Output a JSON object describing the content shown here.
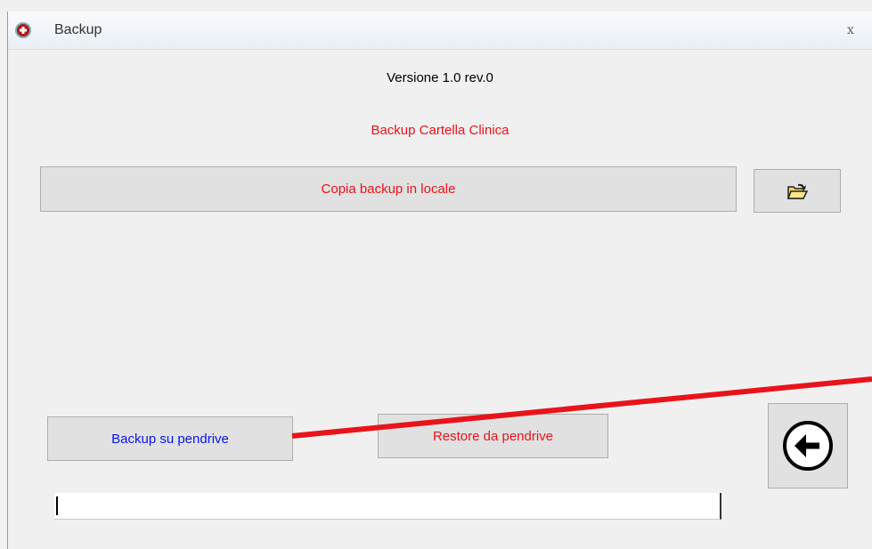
{
  "window": {
    "title": "Backup",
    "close_label": "x"
  },
  "labels": {
    "version": "Versione 1.0 rev.0",
    "heading": "Backup Cartella Clinica"
  },
  "buttons": {
    "copy_local": "Copia backup in locale",
    "backup_pendrive": "Backup su pendrive",
    "restore_pendrive": "Restore da pendrive"
  },
  "progress": {
    "value": ""
  },
  "icons": {
    "app": "medical-cross-icon",
    "folder": "open-folder-icon",
    "back": "back-arrow-icon"
  },
  "colors": {
    "red_text": "#e8141b",
    "blue_text": "#0a15f0",
    "annotation": "#e8141b"
  }
}
